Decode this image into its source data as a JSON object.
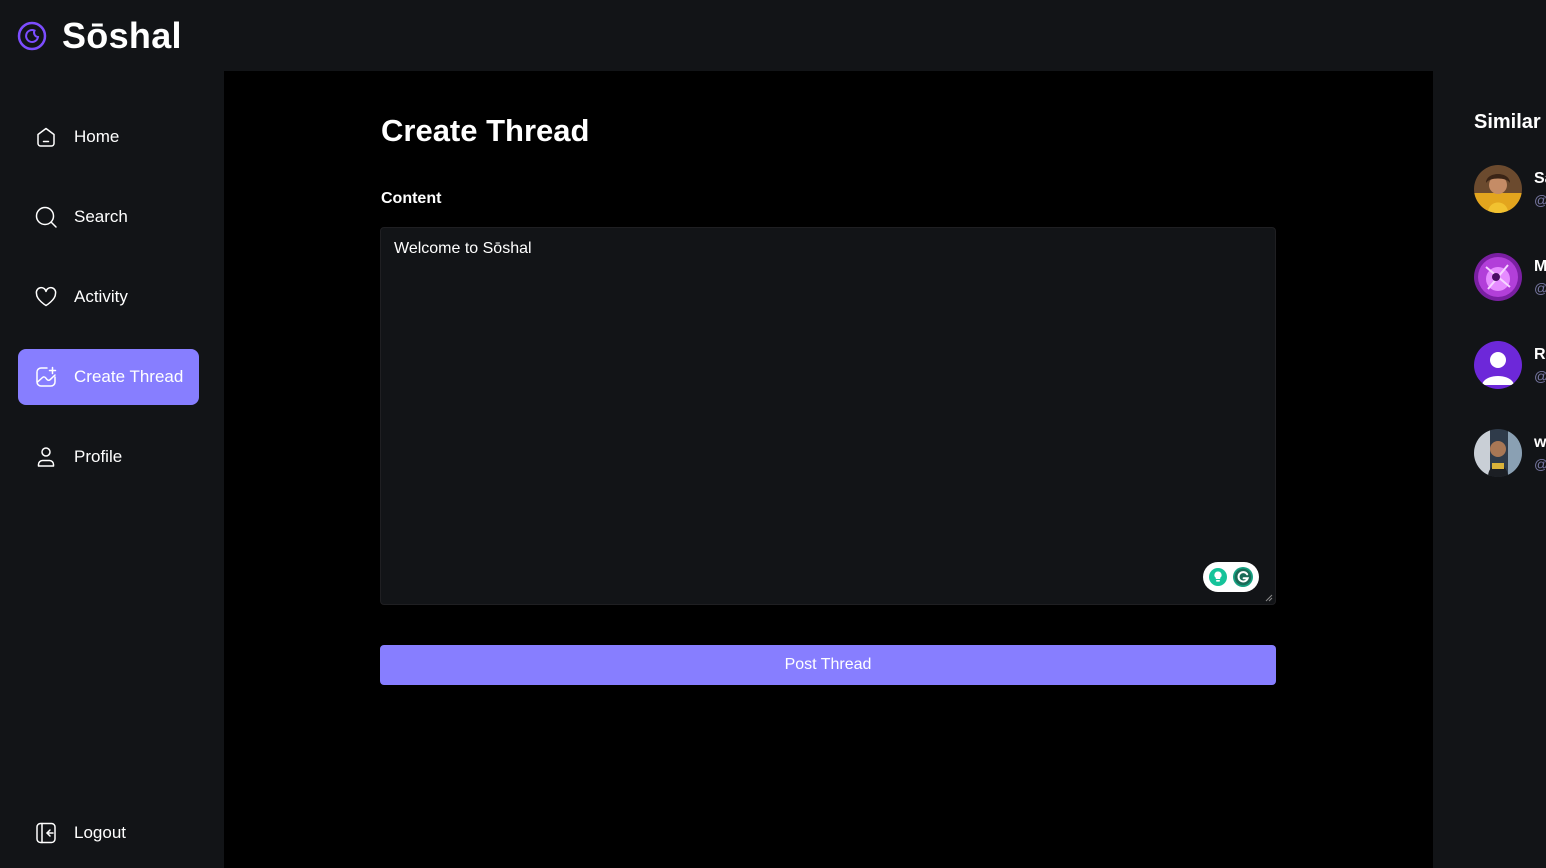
{
  "brand": {
    "name": "Sōshal",
    "logo_icon": "logo-icon"
  },
  "sidebar": {
    "items": [
      {
        "label": "Home",
        "icon": "home-icon"
      },
      {
        "label": "Search",
        "icon": "search-icon"
      },
      {
        "label": "Activity",
        "icon": "heart-icon"
      },
      {
        "label": "Create Thread",
        "icon": "create-thread-icon",
        "active": true
      },
      {
        "label": "Profile",
        "icon": "user-icon"
      }
    ],
    "logout": {
      "label": "Logout",
      "icon": "logout-icon"
    }
  },
  "main": {
    "title": "Create Thread",
    "content_label": "Content",
    "content_value": "Welcome to Sōshal",
    "submit_label": "Post Thread"
  },
  "rightbar": {
    "title": "Similar",
    "users": [
      {
        "name": "Sa",
        "handle": "@",
        "avatar": "photo-avatar"
      },
      {
        "name": "M",
        "handle": "@",
        "avatar": "purple-photo-avatar"
      },
      {
        "name": "Rc",
        "handle": "@",
        "avatar": "default-user-avatar"
      },
      {
        "name": "w",
        "handle": "@",
        "avatar": "photo-avatar"
      }
    ]
  },
  "colors": {
    "accent": "#877eff",
    "background": "#121417",
    "main_background": "#000000",
    "muted_text": "#7878a3"
  }
}
